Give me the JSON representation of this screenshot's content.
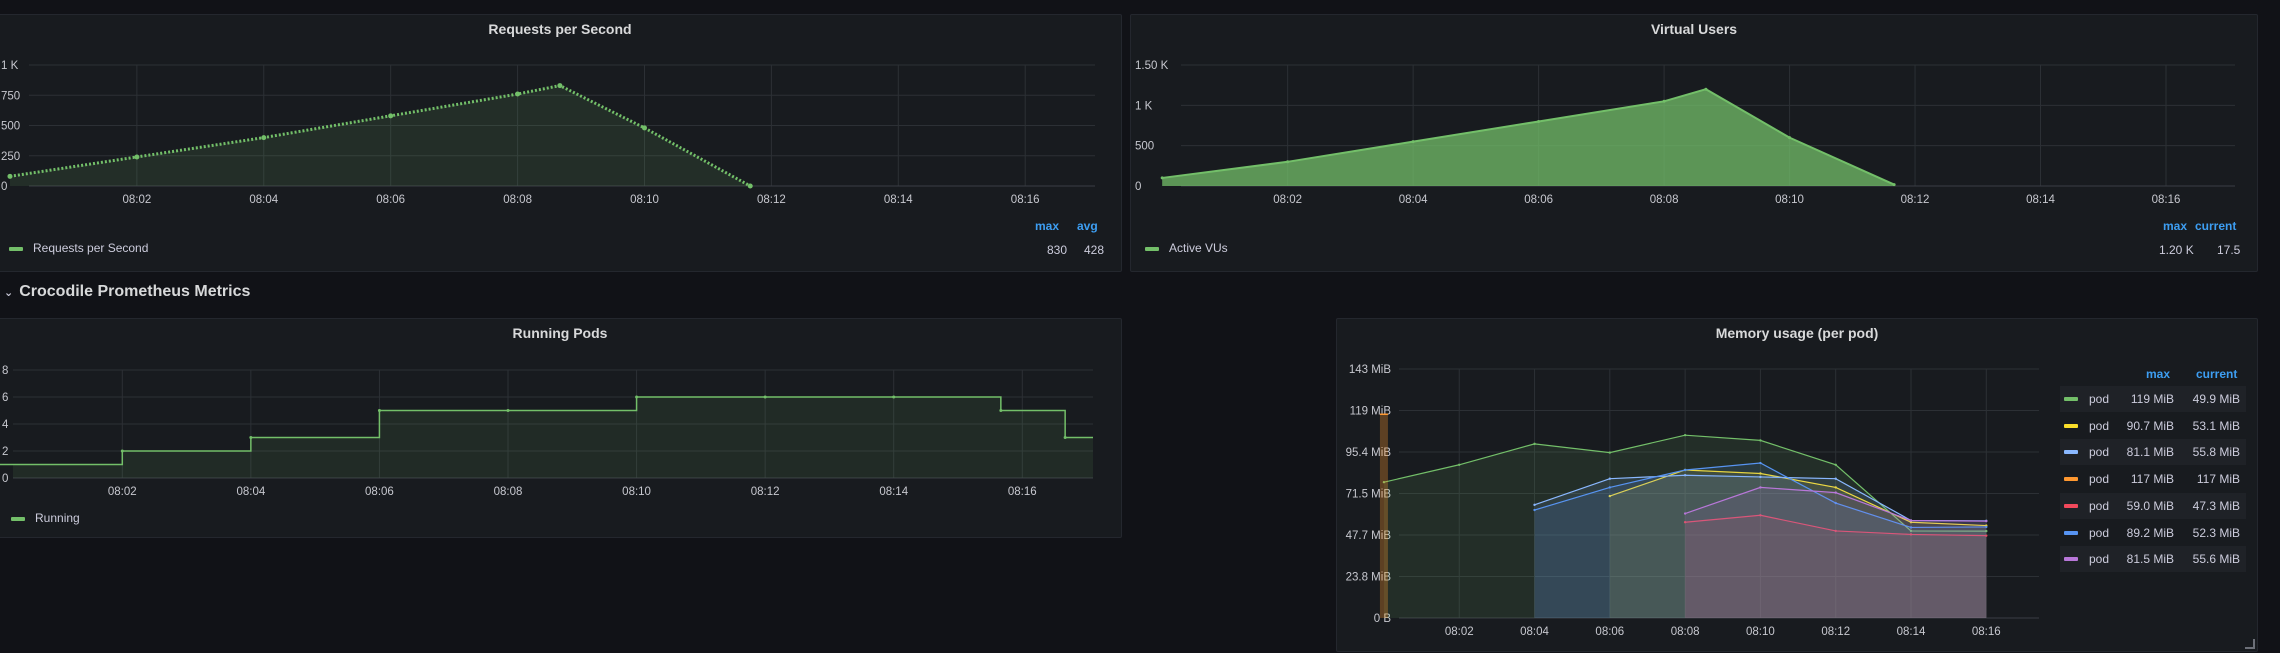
{
  "charts": {
    "rps": {
      "title": "Requests per Second",
      "yticks": [
        "0",
        "250",
        "500",
        "750",
        "1 K"
      ],
      "xticks": [
        "08:02",
        "08:04",
        "08:06",
        "08:08",
        "08:10",
        "08:12",
        "08:14",
        "08:16"
      ],
      "legend": {
        "label": "Requests per Second",
        "headers": [
          "max",
          "avg"
        ],
        "values": [
          "830",
          "428"
        ],
        "color": "#73bf69"
      }
    },
    "vu": {
      "title": "Virtual Users",
      "yticks": [
        "0",
        "500",
        "1 K",
        "1.50 K"
      ],
      "xticks": [
        "08:02",
        "08:04",
        "08:06",
        "08:08",
        "08:10",
        "08:12",
        "08:14",
        "08:16"
      ],
      "legend": {
        "label": "Active VUs",
        "headers": [
          "max",
          "current"
        ],
        "values": [
          "1.20 K",
          "17.5"
        ],
        "color": "#73bf69"
      }
    },
    "pods": {
      "title": "Running Pods",
      "yticks": [
        "0",
        "2",
        "4",
        "6",
        "8"
      ],
      "xticks": [
        "08:02",
        "08:04",
        "08:06",
        "08:08",
        "08:10",
        "08:12",
        "08:14",
        "08:16"
      ],
      "legend": {
        "label": "Running",
        "color": "#73bf69"
      }
    },
    "mem": {
      "title": "Memory usage (per pod)",
      "yticks": [
        "0 B",
        "23.8 MiB",
        "47.7 MiB",
        "71.5 MiB",
        "95.4 MiB",
        "119 MiB",
        "143 MiB"
      ],
      "xticks": [
        "08:02",
        "08:04",
        "08:06",
        "08:08",
        "08:10",
        "08:12",
        "08:14",
        "08:16"
      ],
      "legend": {
        "headers": [
          "max",
          "current"
        ],
        "rows": [
          {
            "name": "pod",
            "max": "119 MiB",
            "current": "49.9 MiB",
            "color": "#73bf69"
          },
          {
            "name": "pod",
            "max": "90.7 MiB",
            "current": "53.1 MiB",
            "color": "#fade2a"
          },
          {
            "name": "pod",
            "max": "81.1 MiB",
            "current": "55.8 MiB",
            "color": "#8ab8ff"
          },
          {
            "name": "pod",
            "max": "117 MiB",
            "current": "117 MiB",
            "color": "#ff9830"
          },
          {
            "name": "pod",
            "max": "59.0 MiB",
            "current": "47.3 MiB",
            "color": "#f2495c"
          },
          {
            "name": "pod",
            "max": "89.2 MiB",
            "current": "52.3 MiB",
            "color": "#5794f2"
          },
          {
            "name": "pod",
            "max": "81.5 MiB",
            "current": "55.6 MiB",
            "color": "#b877d9"
          }
        ]
      }
    }
  },
  "row": {
    "title": "Crocodile Prometheus Metrics"
  },
  "chart_data": [
    {
      "type": "line",
      "title": "Requests per Second",
      "x": [
        "08:00",
        "08:02",
        "08:04",
        "08:06",
        "08:08",
        "08:08:40",
        "08:10",
        "08:11:40"
      ],
      "series": [
        {
          "name": "Requests per Second",
          "values": [
            80,
            240,
            400,
            580,
            760,
            830,
            480,
            0
          ]
        }
      ],
      "ylim": [
        0,
        1000
      ],
      "grid": true,
      "legend": "bottom-left"
    },
    {
      "type": "area",
      "title": "Virtual Users",
      "x": [
        "08:00",
        "08:02",
        "08:04",
        "08:06",
        "08:08",
        "08:08:40",
        "08:10",
        "08:11:40"
      ],
      "series": [
        {
          "name": "Active VUs",
          "values": [
            100,
            300,
            550,
            800,
            1050,
            1200,
            600,
            17.5
          ]
        }
      ],
      "ylim": [
        0,
        1500
      ],
      "grid": true,
      "legend": "bottom-left"
    },
    {
      "type": "line",
      "title": "Running Pods",
      "x": [
        "08:00",
        "08:02",
        "08:04",
        "08:06",
        "08:08",
        "08:10",
        "08:12",
        "08:14",
        "08:15:40",
        "08:16:40"
      ],
      "series": [
        {
          "name": "Running",
          "values": [
            1,
            2,
            3,
            5,
            5,
            6,
            6,
            6,
            5,
            3
          ]
        }
      ],
      "ylim": [
        0,
        8
      ],
      "grid": true,
      "legend": "bottom-left"
    },
    {
      "type": "line",
      "title": "Memory usage (per pod)",
      "x": [
        "08:00",
        "08:02",
        "08:04",
        "08:06",
        "08:08",
        "08:10",
        "08:12",
        "08:14",
        "08:16"
      ],
      "series": [
        {
          "name": "pod",
          "values": [
            78,
            88,
            100,
            95,
            105,
            102,
            88,
            50,
            49.9
          ]
        },
        {
          "name": "pod",
          "values": [
            null,
            null,
            null,
            70,
            85,
            83,
            75,
            55,
            53.1
          ]
        },
        {
          "name": "pod",
          "values": [
            null,
            null,
            65,
            80,
            82,
            81,
            80,
            56,
            55.8
          ]
        },
        {
          "name": "pod",
          "values": [
            117,
            null,
            null,
            null,
            null,
            null,
            null,
            null,
            null
          ]
        },
        {
          "name": "pod",
          "values": [
            null,
            null,
            null,
            null,
            55,
            59,
            50,
            48,
            47.3
          ]
        },
        {
          "name": "pod",
          "values": [
            null,
            null,
            62,
            75,
            85,
            89,
            66,
            52,
            52.3
          ]
        },
        {
          "name": "pod",
          "values": [
            null,
            null,
            null,
            null,
            60,
            75,
            72,
            56,
            55.6
          ]
        }
      ],
      "ylim": [
        0,
        143
      ],
      "grid": true,
      "legend": "right"
    }
  ]
}
